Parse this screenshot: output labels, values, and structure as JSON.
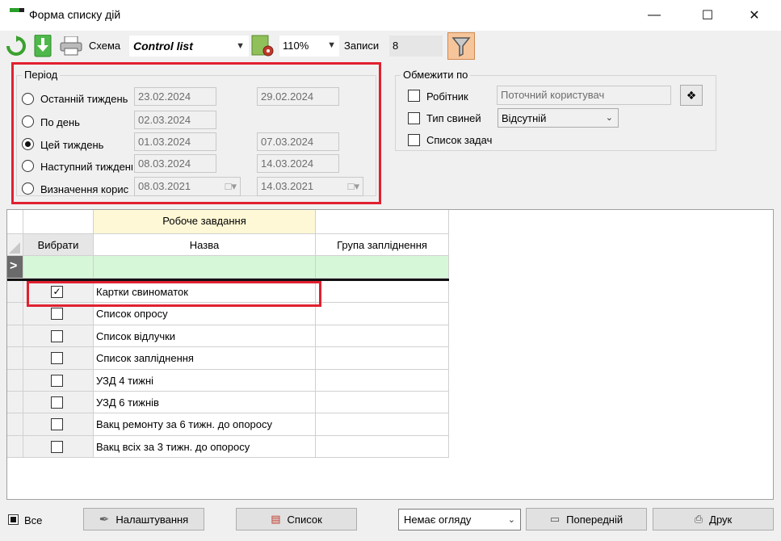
{
  "window": {
    "title": "Форма списку дій"
  },
  "toolbar": {
    "schema_label": "Схема",
    "schema_value": "Control list",
    "zoom_value": "110%",
    "records_label": "Записи",
    "records_value": "8"
  },
  "period": {
    "legend": "Період",
    "options": [
      {
        "label": "Останній тиждень",
        "from": "23.02.2024",
        "to": "29.02.2024"
      },
      {
        "label": "По день",
        "from": "02.03.2024",
        "to": ""
      },
      {
        "label": "Цей тиждень",
        "from": "01.03.2024",
        "to": "07.03.2024"
      },
      {
        "label": "Наступний тиждень",
        "from": "08.03.2024",
        "to": "14.03.2024"
      },
      {
        "label": "Визначення корис",
        "from": "08.03.2021",
        "to": "14.03.2021"
      }
    ]
  },
  "limit": {
    "legend": "Обмежити по",
    "worker_label": "Робітник",
    "worker_value": "Поточний користувач",
    "pigtype_label": "Тип свиней",
    "pigtype_value": "Відсутній",
    "tasklist_label": "Список задач"
  },
  "grid": {
    "group_header": "Робоче завдання",
    "col_select": "Вибрати",
    "col_name": "Назва",
    "col_group": "Група запліднення",
    "rows": [
      {
        "name": "Картки свиноматок",
        "checked": true
      },
      {
        "name": "Список опросу",
        "checked": false
      },
      {
        "name": "Список відлучки",
        "checked": false
      },
      {
        "name": "Список запліднення",
        "checked": false
      },
      {
        "name": "УЗД 4 тижні",
        "checked": false
      },
      {
        "name": "УЗД 6 тижнів",
        "checked": false
      },
      {
        "name": "Вакц ремонту за 6 тижн. до опоросу",
        "checked": false
      },
      {
        "name": "Вакц всіх за 3 тижн. до опоросу",
        "checked": false
      }
    ]
  },
  "footer": {
    "all_label": "Все",
    "settings_label": "Налаштування",
    "list_label": "Список",
    "preview_select": "Немає огляду",
    "prev_label": "Попередній",
    "print_label": "Друк"
  }
}
